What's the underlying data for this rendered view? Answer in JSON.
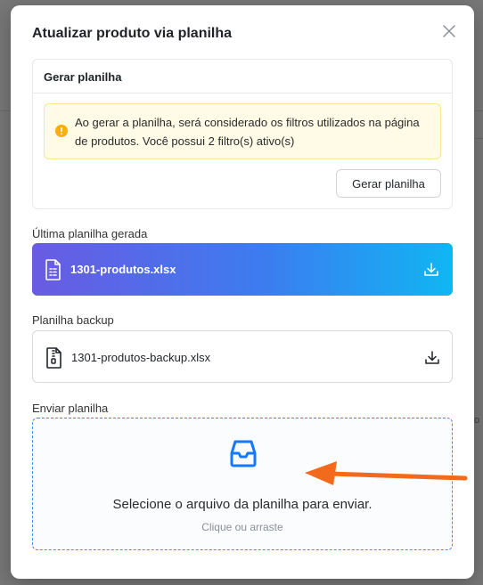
{
  "background": {
    "fragment": "o"
  },
  "modal": {
    "title": "Atualizar produto via planilha",
    "close_icon": "close-icon"
  },
  "generate": {
    "header": "Gerar planilha",
    "alert_text": "Ao gerar a planilha, será considerado os filtros utilizados na página de produtos. Você possui 2 filtro(s) ativo(s)",
    "alert_icon": "warning-icon",
    "button_label": "Gerar planilha"
  },
  "latest": {
    "label": "Última planilha gerada",
    "file_name": "1301-produtos.xlsx",
    "file_icon": "spreadsheet-file-icon",
    "download_icon": "download-icon"
  },
  "backup": {
    "label": "Planilha backup",
    "file_name": "1301-produtos-backup.xlsx",
    "file_icon": "archive-file-icon",
    "download_icon": "download-icon"
  },
  "upload": {
    "label": "Enviar planilha",
    "main_text": "Selecione o arquivo da planilha para enviar.",
    "sub_text": "Clique ou arraste",
    "icon": "inbox-icon"
  },
  "colors": {
    "accent": "#3d8af7",
    "gradient_start": "#6a5be2",
    "gradient_end": "#10b6f3",
    "warning": "#faad14",
    "annotation_arrow": "#f26a1b"
  }
}
